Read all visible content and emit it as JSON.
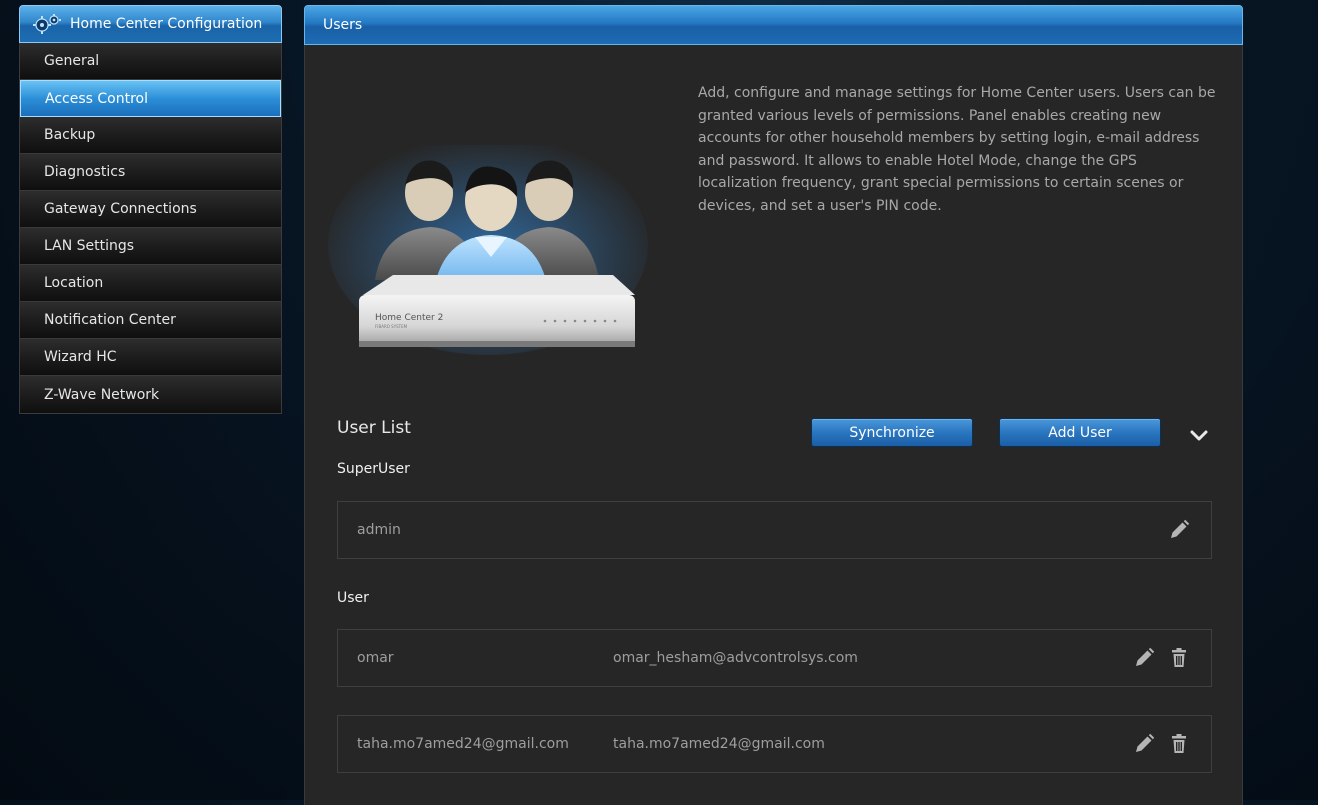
{
  "sidebar": {
    "title": "Home Center Configuration",
    "header_icon": "gears-icon",
    "items": [
      {
        "label": "General",
        "active": false
      },
      {
        "label": "Access Control",
        "active": true
      },
      {
        "label": "Backup",
        "active": false
      },
      {
        "label": "Diagnostics",
        "active": false
      },
      {
        "label": "Gateway Connections",
        "active": false
      },
      {
        "label": "LAN Settings",
        "active": false
      },
      {
        "label": "Location",
        "active": false
      },
      {
        "label": "Notification Center",
        "active": false
      },
      {
        "label": "Wizard HC",
        "active": false
      },
      {
        "label": "Z-Wave Network",
        "active": false
      }
    ]
  },
  "panel": {
    "title": "Users",
    "description": "Add, configure and manage settings for Home Center users. Users can be granted various levels of permissions. Panel enables creating new accounts for other household members by setting login, e-mail address and password. It allows to enable Hotel Mode, change the GPS localization frequency, grant special permissions to certain scenes or devices, and set a user's PIN code.",
    "hero_device_label": "Home Center 2",
    "hero_device_sublabel": "FIBARO SYSTEM"
  },
  "user_list": {
    "title": "User List",
    "synchronize_label": "Synchronize",
    "add_user_label": "Add User",
    "expand_icon": "chevron-down-icon",
    "superuser_label": "SuperUser",
    "superusers": [
      {
        "name": "admin",
        "email": ""
      }
    ],
    "user_label": "User",
    "users": [
      {
        "name": "omar",
        "email": "omar_hesham@advcontrolsys.com"
      },
      {
        "name": "taha.mo7amed24@gmail.com",
        "email": "taha.mo7amed24@gmail.com"
      }
    ]
  },
  "colors": {
    "accent_blue": "#2a76c0",
    "panel_bg": "#262626",
    "text_muted": "#a8a8a8"
  }
}
